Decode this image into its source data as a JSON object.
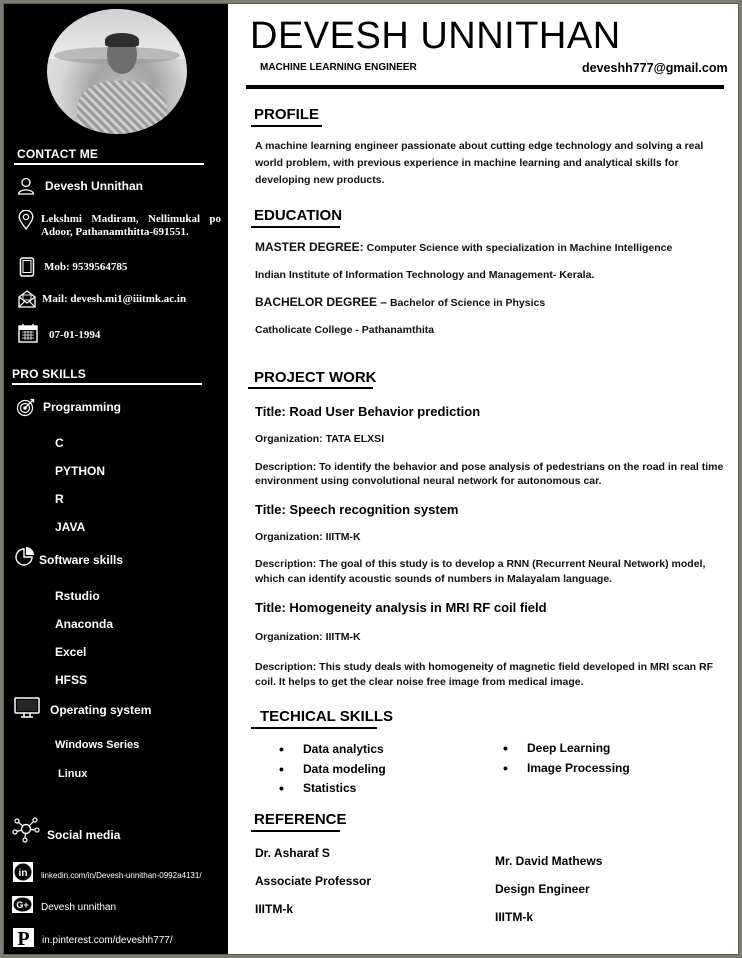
{
  "header": {
    "name": "DEVESH UNNITHAN",
    "role": "MACHINE LEARNING ENGINEER",
    "email": "deveshh777@gmail.com"
  },
  "sidebar": {
    "contact": {
      "heading": "CONTACT   ME",
      "items": [
        {
          "icon": "person-icon",
          "text": "Devesh Unnithan"
        },
        {
          "icon": "location-pin-icon",
          "text": "Lekshmi  Madiram,  Nellimukal  po Adoor, Pathanamthitta-691551."
        },
        {
          "icon": "mobile-phone-icon",
          "text": "Mob:  9539564785"
        },
        {
          "icon": "mail-icon",
          "text": "Mail: devesh.mi1@iiitmk.ac.in"
        },
        {
          "icon": "calendar-icon",
          "text": "07-01-1994"
        }
      ]
    },
    "pro_skills": {
      "heading": "PRO SKILLS",
      "groups": [
        {
          "icon": "target-icon",
          "title": "Programming",
          "items": [
            "C",
            "PYTHON",
            "R",
            "JAVA"
          ]
        },
        {
          "icon": "pie-chart-icon",
          "title": "Software skills",
          "items": [
            "Rstudio",
            "Anaconda",
            "Excel",
            "HFSS"
          ]
        },
        {
          "icon": "monitor-icon",
          "title": "Operating system",
          "items": [
            "Windows Series",
            "Linux"
          ]
        }
      ]
    },
    "social": {
      "icon": "network-icon",
      "title": "Social media",
      "items": [
        {
          "icon": "linkedin-icon",
          "text": "linkedin.com/in/Devesh-unnithan-0992a4131/"
        },
        {
          "icon": "google-plus-icon",
          "text": "Devesh unnithan"
        },
        {
          "icon": "pinterest-icon",
          "text": "in.pinterest.com/deveshh777/"
        }
      ]
    }
  },
  "profile": {
    "heading": "PROFILE",
    "lines": [
      "A machine learning engineer passionate about cutting edge technology and solving a real",
      "world problem, with previous experience in machine learning and analytical skills for",
      "developing new products."
    ]
  },
  "education": {
    "heading": "EDUCATION",
    "master_label": "MASTER DEGREE:",
    "master_value": " Computer Science with specialization in Machine Intelligence",
    "master_school": "Indian Institute of Information Technology and Management- Kerala.",
    "bachelor_label": "BACHELOR DEGREE –",
    "bachelor_value": " Bachelor of Science in Physics",
    "bachelor_school": "Catholicate College - Pathanamthita"
  },
  "projects": {
    "heading": "PROJECT WORK",
    "items": [
      {
        "title": "Title: Road User Behavior prediction",
        "org": "Organization: TATA ELXSI",
        "desc1": "Description: To identify the behavior and pose analysis of pedestrians on the road in real time",
        "desc2": "environment using convolutional neural network for autonomous car."
      },
      {
        "title": "Title: Speech recognition system",
        "org": "Organization: IIITM-K",
        "desc1": "Description:  The goal of this study is to develop a RNN (Recurrent Neural Network) model,",
        "desc2": "which can identify acoustic sounds of numbers in Malayalam language."
      },
      {
        "title": "Title: Homogeneity analysis in MRI RF coil field",
        "org": "Organization: IIITM-K",
        "desc1": "Description: This study deals with homogeneity of magnetic field developed in MRI scan RF",
        "desc2": "coil. It helps to get the clear noise free image from medical image."
      }
    ]
  },
  "technical_skills": {
    "heading": "TECHICAL SKILLS",
    "col1": [
      "Data analytics",
      "Data modeling",
      "Statistics"
    ],
    "col2": [
      "Deep Learning",
      "Image Processing"
    ]
  },
  "reference": {
    "heading": "REFERENCE",
    "people": [
      {
        "name": "Dr. Asharaf S",
        "title": "Associate Professor",
        "org": "IIITM-k"
      },
      {
        "name": "Mr. David Mathews",
        "title": "Design Engineer",
        "org": "IIITM-k"
      }
    ]
  }
}
